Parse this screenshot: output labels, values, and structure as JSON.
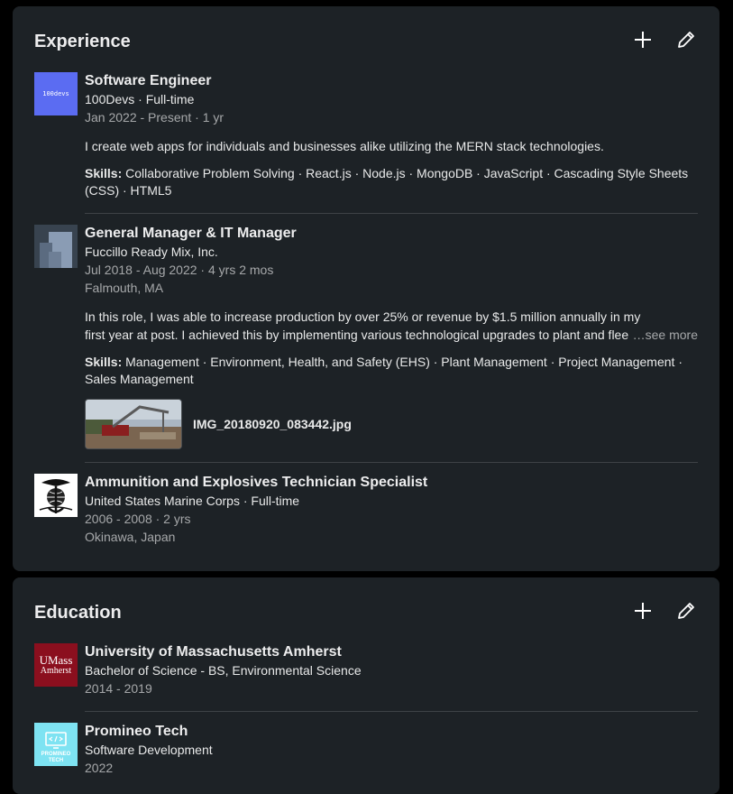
{
  "experience": {
    "title": "Experience",
    "add_icon": "plus-icon",
    "edit_icon": "pencil-icon",
    "items": [
      {
        "logo_text": "100devs",
        "role": "Software Engineer",
        "company": "100Devs · Full-time",
        "dates": "Jan 2022 - Present · 1 yr",
        "description": "I create web apps for individuals and businesses alike utilizing the MERN stack technologies.",
        "skills_label": "Skills:",
        "skills": " Collaborative Problem Solving · React.js · Node.js · MongoDB · JavaScript · Cascading Style Sheets (CSS) · HTML5"
      },
      {
        "role": "General Manager & IT Manager",
        "company": "Fuccillo Ready Mix, Inc.",
        "dates": "Jul 2018 - Aug 2022 · 4 yrs 2 mos",
        "location": "Falmouth, MA",
        "description_line1": "In this role, I was able to increase production by over 25% or revenue by $1.5 million annually in my",
        "description_line2": "first year at post. I achieved this by implementing various technological upgrades to plant and flee",
        "see_more": "…see more",
        "skills_label": "Skills:",
        "skills": " Management · Environment, Health, and Safety (EHS) · Plant Management · Project Management · Sales Management",
        "media_name": "IMG_20180920_083442.jpg"
      },
      {
        "role": "Ammunition and Explosives Technician Specialist",
        "company": "United States Marine Corps · Full-time",
        "dates": "2006 - 2008 · 2 yrs",
        "location": "Okinawa, Japan"
      }
    ]
  },
  "education": {
    "title": "Education",
    "add_icon": "plus-icon",
    "edit_icon": "pencil-icon",
    "items": [
      {
        "logo_text_1": "UMass",
        "logo_text_2": "Amherst",
        "school": "University of Massachusetts Amherst",
        "degree": "Bachelor of Science - BS, Environmental Science",
        "dates": "2014 - 2019"
      },
      {
        "logo_text_1": "PROMINEO",
        "logo_text_2": "TECH",
        "school": "Promineo Tech",
        "degree": "Software Development",
        "dates": "2022"
      }
    ]
  },
  "colors": {
    "page_bg": "#000000",
    "card_bg": "#1d2226",
    "devs_logo": "#5b6cf2",
    "umass_logo": "#8b0f1e",
    "promineo_logo": "#7ee3f2"
  }
}
